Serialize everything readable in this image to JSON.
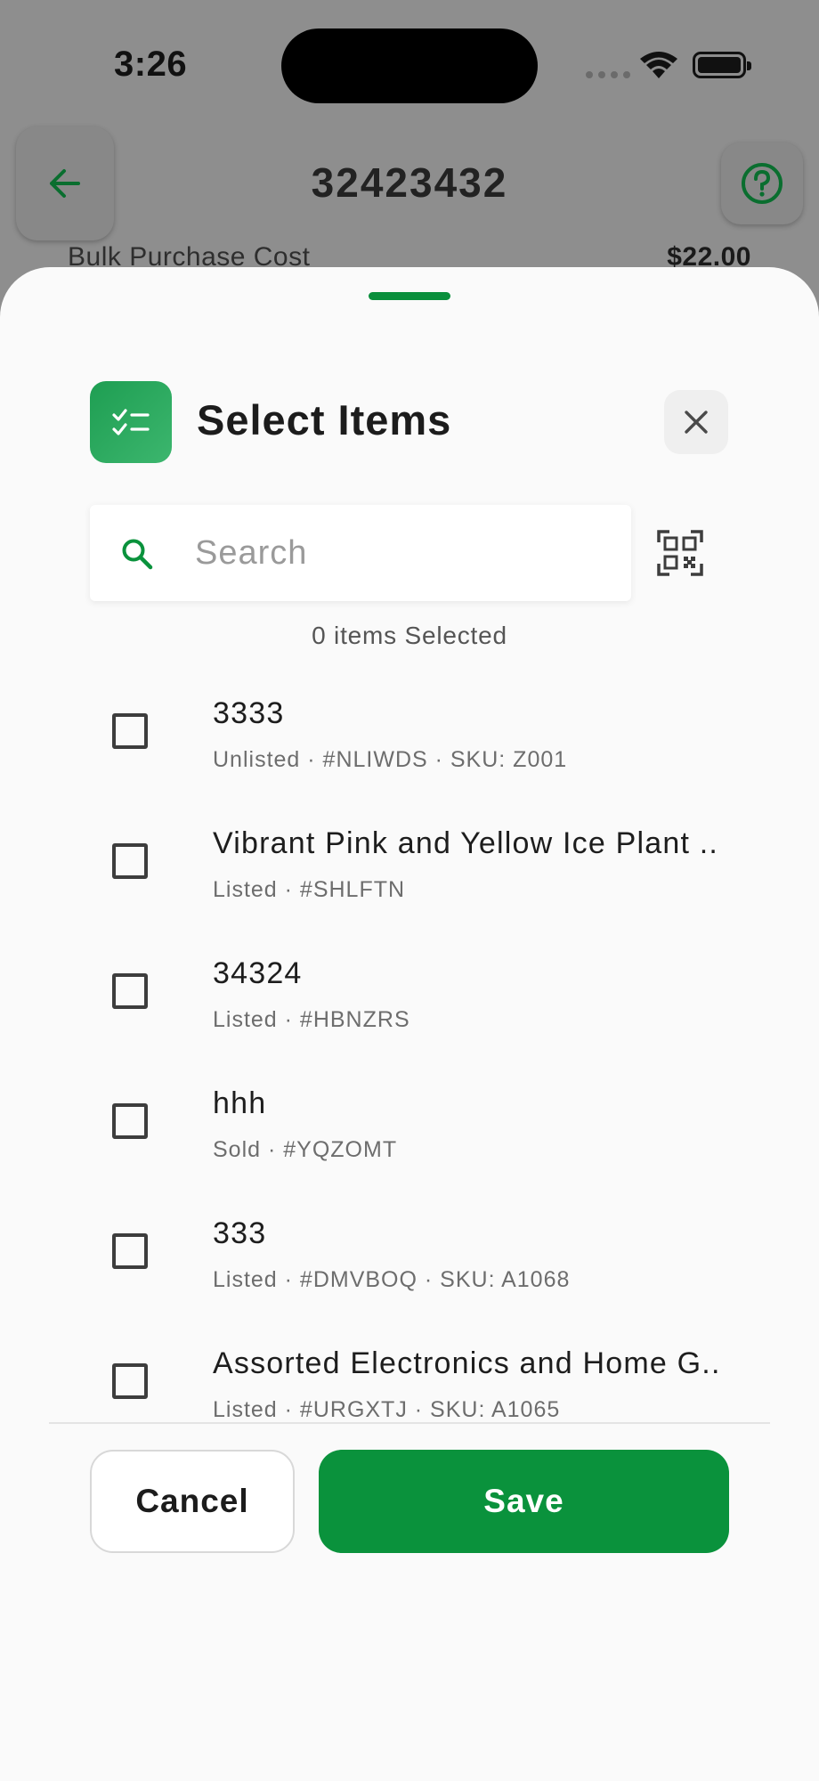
{
  "status_bar": {
    "time": "3:26",
    "icons": [
      "signal-dots-icon",
      "wifi-icon",
      "battery-icon"
    ]
  },
  "background_screen": {
    "title": "32423432",
    "back_icon": "arrow-left-icon",
    "help_icon": "question-circle-icon",
    "row": {
      "label": "Bulk Purchase Cost",
      "value": "$22.00"
    }
  },
  "sheet": {
    "title": "Select Items",
    "header_icon": "checklist-icon",
    "close_icon": "close-icon",
    "search": {
      "placeholder": "Search",
      "value": "",
      "icon": "search-icon",
      "scan_icon": "qr-code-icon"
    },
    "selected_count": "0 items Selected",
    "items": [
      {
        "title": "3333",
        "subtitle": "Unlisted · #NLIWDS · SKU: Z001",
        "checked": false
      },
      {
        "title": "Vibrant Pink and Yellow Ice Plant ...",
        "subtitle": "Listed · #SHLFTN",
        "checked": false
      },
      {
        "title": "34324",
        "subtitle": "Listed · #HBNZRS",
        "checked": false
      },
      {
        "title": "hhh",
        "subtitle": "Sold · #YQZOMT",
        "checked": false
      },
      {
        "title": "333",
        "subtitle": "Listed · #DMVBOQ · SKU: A1068",
        "checked": false
      },
      {
        "title": "Assorted Electronics and Home G...",
        "subtitle": "Listed · #URGXTJ · SKU: A1065",
        "checked": false
      }
    ],
    "cancel_label": "Cancel",
    "save_label": "Save"
  },
  "colors": {
    "accent_green": "#0a923c",
    "overlay_gray": "#8e8e8e",
    "sheet_bg": "#fafafa"
  }
}
